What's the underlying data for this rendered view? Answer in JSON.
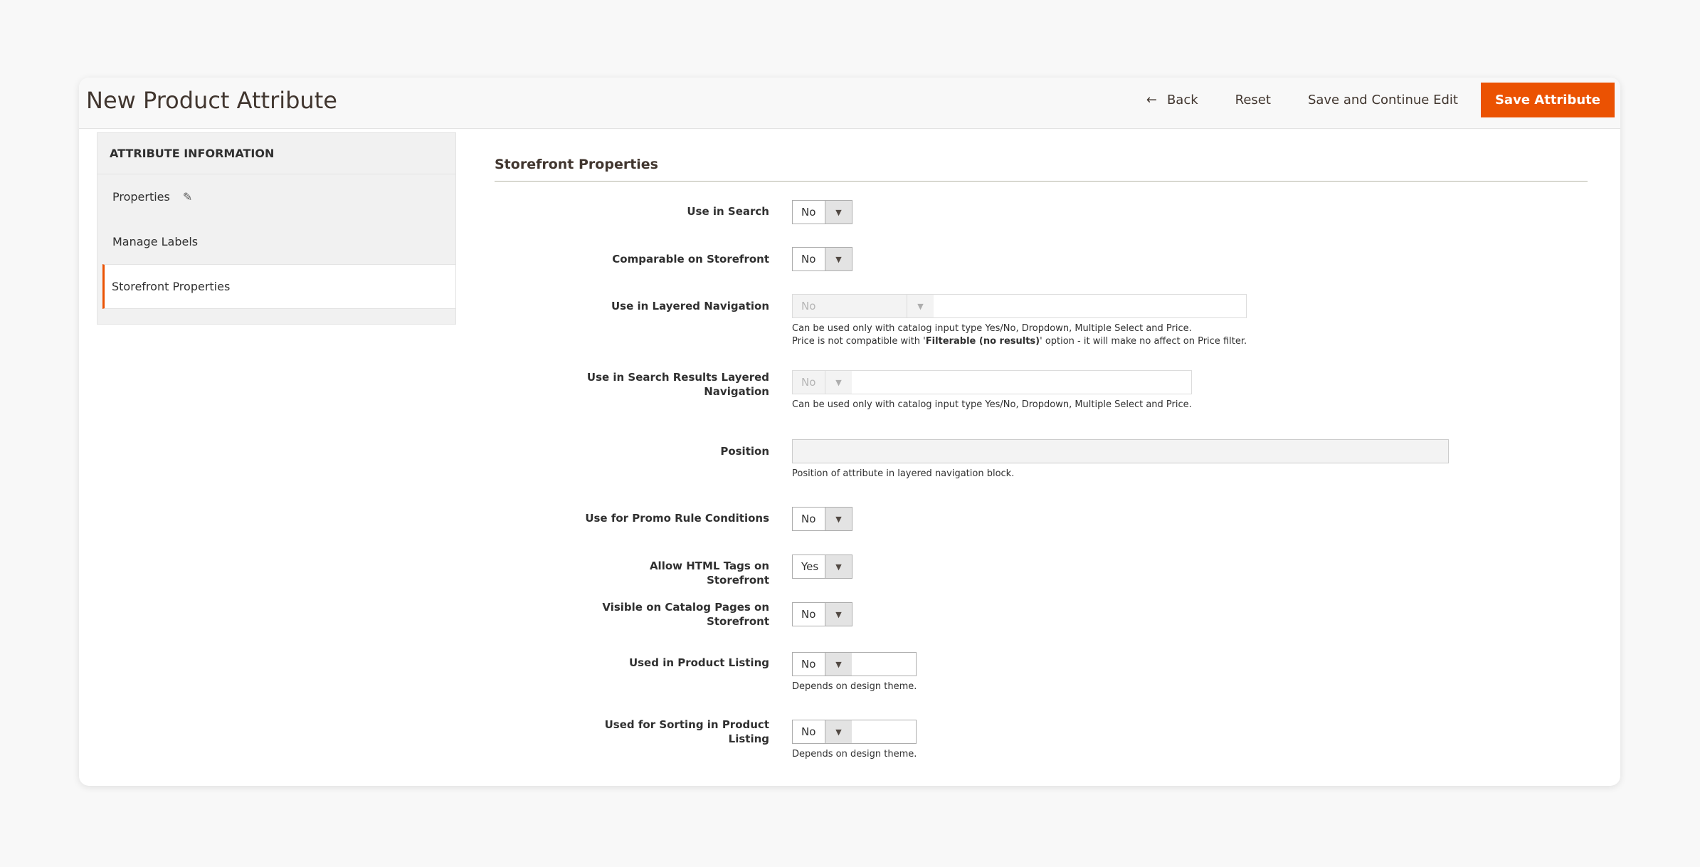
{
  "header": {
    "title": "New Product Attribute",
    "back_label": "Back",
    "reset_label": "Reset",
    "save_continue_label": "Save and Continue Edit",
    "save_label": "Save Attribute",
    "back_icon": "arrow-left-icon"
  },
  "sidebar": {
    "heading": "ATTRIBUTE INFORMATION",
    "items": [
      {
        "label": "Properties",
        "icon": "pencil-icon"
      },
      {
        "label": "Manage Labels"
      },
      {
        "label": "Storefront Properties",
        "active": true
      }
    ]
  },
  "section": {
    "title_part1": "Storefront",
    "title_part2": " Properties"
  },
  "fields": {
    "use_in_search": {
      "label": "Use in Search",
      "value": "No"
    },
    "comparable": {
      "label": "Comparable on Storefront",
      "value": "No"
    },
    "layered_nav": {
      "label": "Use in Layered Navigation",
      "value": "No",
      "note1": "Can be used only with catalog input type Yes/No, Dropdown, Multiple Select and Price.",
      "note2_prefix": "Price is not compatible with '",
      "note2_bold": "Filterable (no results)",
      "note2_suffix": "' option - it will make no affect on Price filter."
    },
    "search_layered_nav": {
      "label": "Use in Search Results Layered Navigation",
      "value": "No",
      "note": "Can be used only with catalog input type Yes/No, Dropdown, Multiple Select and Price."
    },
    "position": {
      "label": "Position",
      "value": "",
      "note": "Position of attribute in layered navigation block."
    },
    "promo_rules": {
      "label": "Use for Promo Rule Conditions",
      "value": "No"
    },
    "html_tags": {
      "label": "Allow HTML Tags on Storefront",
      "value": "Yes"
    },
    "visible_catalog": {
      "label": "Visible on Catalog Pages on Storefront",
      "value": "No"
    },
    "product_listing": {
      "label": "Used in Product Listing",
      "value": "No",
      "note": "Depends on design theme."
    },
    "sorting": {
      "label": "Used for Sorting in Product Listing",
      "value": "No",
      "note": "Depends on design theme."
    }
  },
  "colors": {
    "accent": "#eb5202",
    "text": "#41362f",
    "background": "#f8f8f8"
  }
}
